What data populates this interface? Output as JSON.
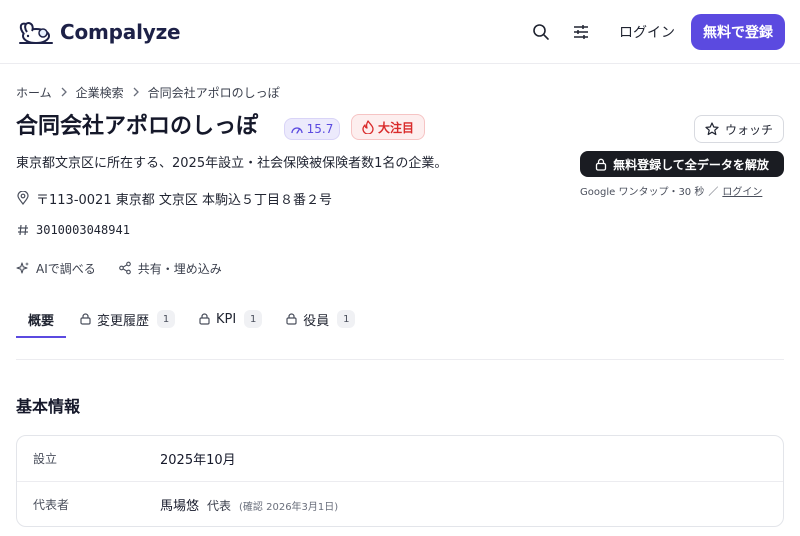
{
  "header": {
    "logo_text": "Compalyze",
    "search_icon": "search-icon",
    "filter_icon": "sliders-icon",
    "login_label": "ログイン",
    "signup_label": "無料で登録",
    "accent_color": "#5b4ae0"
  },
  "breadcrumb": [
    "ホーム",
    "企業検索",
    "合同会社アポロのしっぽ"
  ],
  "company": {
    "name": "合同会社アポロのしっぽ",
    "score": "15.7",
    "hot_label": "大注目",
    "description": "東京都文京区に所在する、2025年設立・社会保険被保険者数1名の企業。",
    "address": "〒113-0021 東京都 文京区 本駒込５丁目８番２号",
    "corporate_number": "3010003048941"
  },
  "watch_label": "ウォッチ",
  "unlock": {
    "button_label": "無料登録して全データを解放",
    "note": "Google ワンタップ・30 秒",
    "note_sep": "／",
    "note_login": "ログイン"
  },
  "actions": {
    "ai_label": "AIで調べる",
    "share_label": "共有・埋め込み"
  },
  "tabs": [
    {
      "label": "概要",
      "locked": false,
      "count": null
    },
    {
      "label": "変更履歴",
      "locked": true,
      "count": "1"
    },
    {
      "label": "KPI",
      "locked": true,
      "count": "1"
    },
    {
      "label": "役員",
      "locked": true,
      "count": "1"
    }
  ],
  "basic_info": {
    "title": "基本情報",
    "rows": [
      {
        "label": "設立",
        "value": "2025年10月"
      },
      {
        "label": "代表者",
        "value": "馬場悠",
        "role": "代表",
        "confirmed": "(確認 2026年3月1日)"
      }
    ]
  },
  "colors": {
    "hot": "#d92b2b",
    "dark_button": "#1a1c22"
  }
}
